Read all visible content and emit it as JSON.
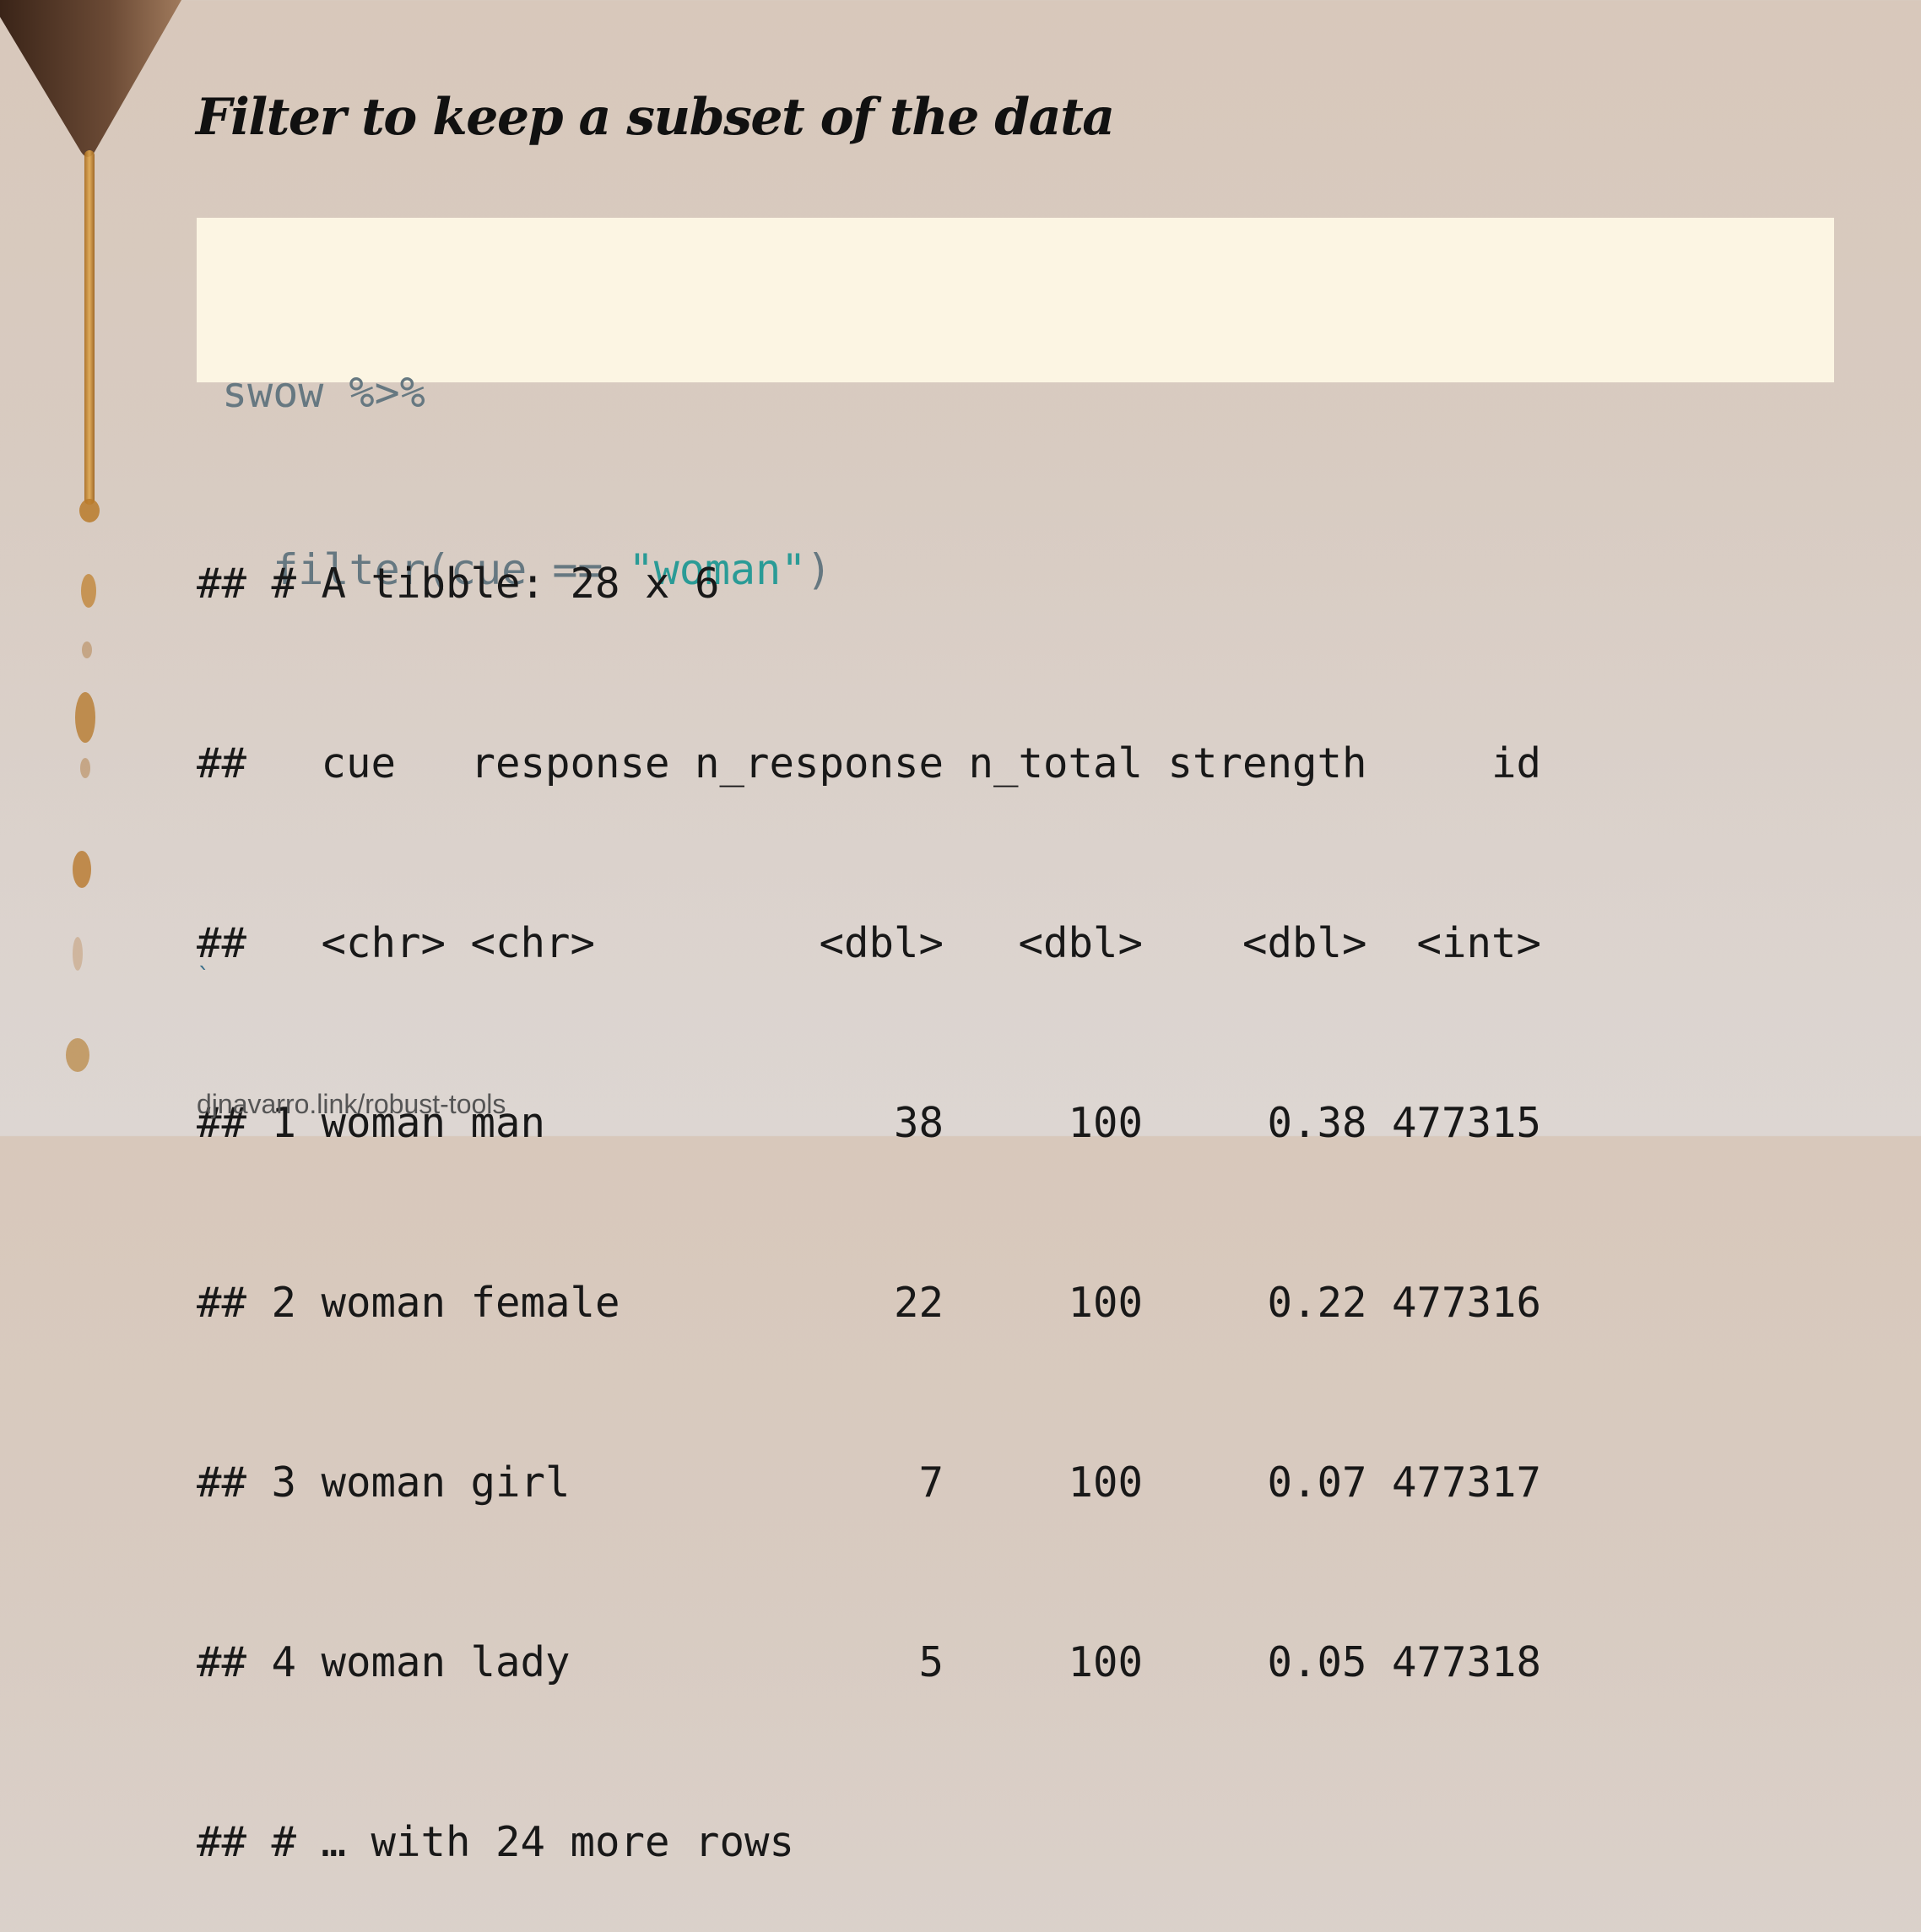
{
  "title": "Filter to keep a subset of the data",
  "code": {
    "line1": "swow %>%",
    "line2_prefix": "  filter(cue == ",
    "line2_string": "\"woman\"",
    "line2_suffix": ")"
  },
  "output": {
    "lines": [
      "## # A tibble: 28 x 6",
      "##   cue   response n_response n_total strength     id",
      "##   <chr> <chr>         <dbl>   <dbl>    <dbl>  <int>",
      "## 1 woman man              38     100     0.38 477315",
      "## 2 woman female           22     100     0.22 477316",
      "## 3 woman girl              7     100     0.07 477317",
      "## 4 woman lady              5     100     0.05 477318",
      "## # … with 24 more rows"
    ]
  },
  "stray_mark": "`",
  "footer": {
    "link_text": "djnavarro.link/robust-tools"
  },
  "colors": {
    "code_background": "#fcf5e3",
    "code_text": "#667881",
    "code_string": "#2a9b96"
  }
}
